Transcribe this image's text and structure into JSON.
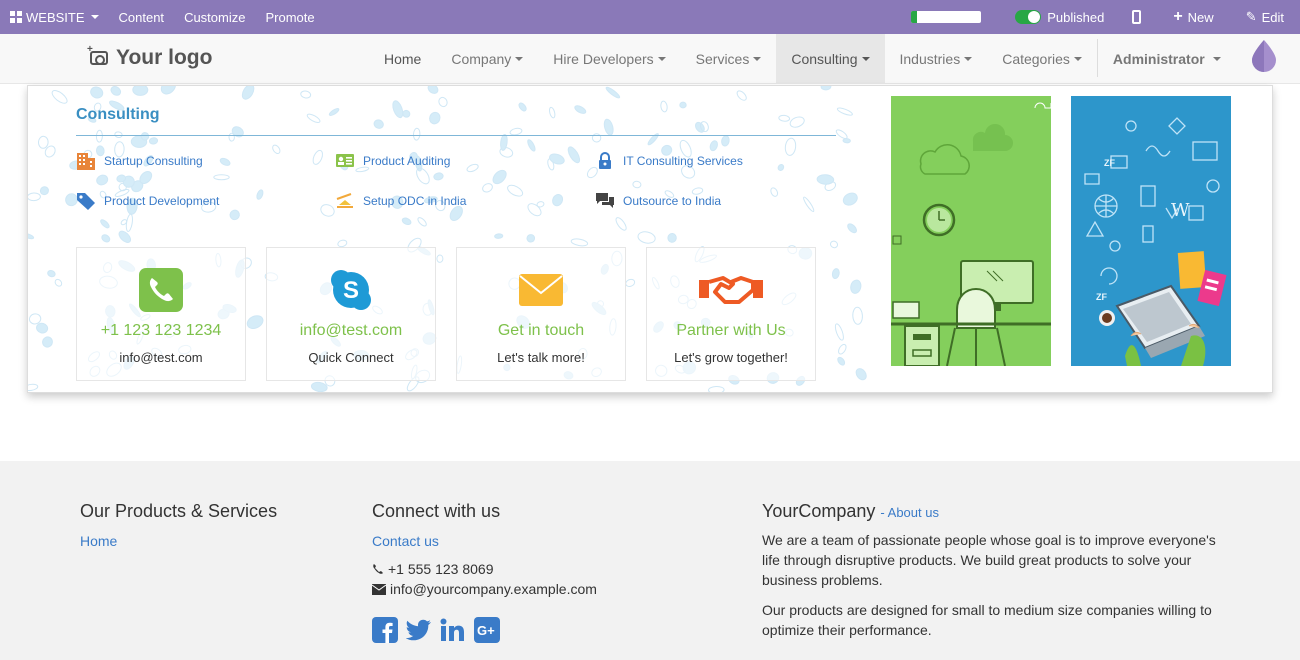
{
  "admin_bar": {
    "website_label": "WEBSITE",
    "content_label": "Content",
    "customize_label": "Customize",
    "promote_label": "Promote",
    "seo_progress": 0.08,
    "published_label": "Published",
    "new_label": "New",
    "edit_label": "Edit",
    "bg_color": "#8a79b8"
  },
  "navbar": {
    "logo_text": "Your logo",
    "items": [
      {
        "label": "Home"
      },
      {
        "label": "Company"
      },
      {
        "label": "Hire Developers"
      },
      {
        "label": "Services"
      },
      {
        "label": "Consulting"
      },
      {
        "label": "Industries"
      },
      {
        "label": "Categories"
      }
    ],
    "user_label": "Administrator"
  },
  "mega_menu": {
    "title": "Consulting",
    "links": [
      {
        "label": "Startup Consulting",
        "icon": "building-icon"
      },
      {
        "label": "Product Auditing",
        "icon": "id-card-icon"
      },
      {
        "label": "IT Consulting Services",
        "icon": "lock-icon"
      },
      {
        "label": "Product Development",
        "icon": "tag-icon"
      },
      {
        "label": "Setup ODC in India",
        "icon": "flag-icon"
      },
      {
        "label": "Outsource to India",
        "icon": "chat-icon"
      }
    ],
    "cards": [
      {
        "title": "+1 123 123 1234",
        "subtitle": "info@test.com",
        "icon": "phone-icon"
      },
      {
        "title": "info@test.com",
        "subtitle": "Quick Connect",
        "icon": "skype-icon"
      },
      {
        "title": "Get in touch",
        "subtitle": "Let's talk more!",
        "icon": "envelope-icon"
      },
      {
        "title": "Partner with Us",
        "subtitle": "Let's grow together!",
        "icon": "handshake-icon"
      }
    ]
  },
  "footer": {
    "products": {
      "title": "Our Products & Services",
      "link": "Home"
    },
    "connect": {
      "title": "Connect with us",
      "link": "Contact us",
      "phone": "+1 555 123 8069",
      "email": "info@yourcompany.example.com"
    },
    "company": {
      "name": "YourCompany",
      "about_link": "- About us",
      "para1": "We are a team of passionate people whose goal is to improve everyone's life through disruptive products. We build great products to solve your business problems.",
      "para2": "Our products are designed for small to medium size companies willing to optimize their performance."
    }
  }
}
